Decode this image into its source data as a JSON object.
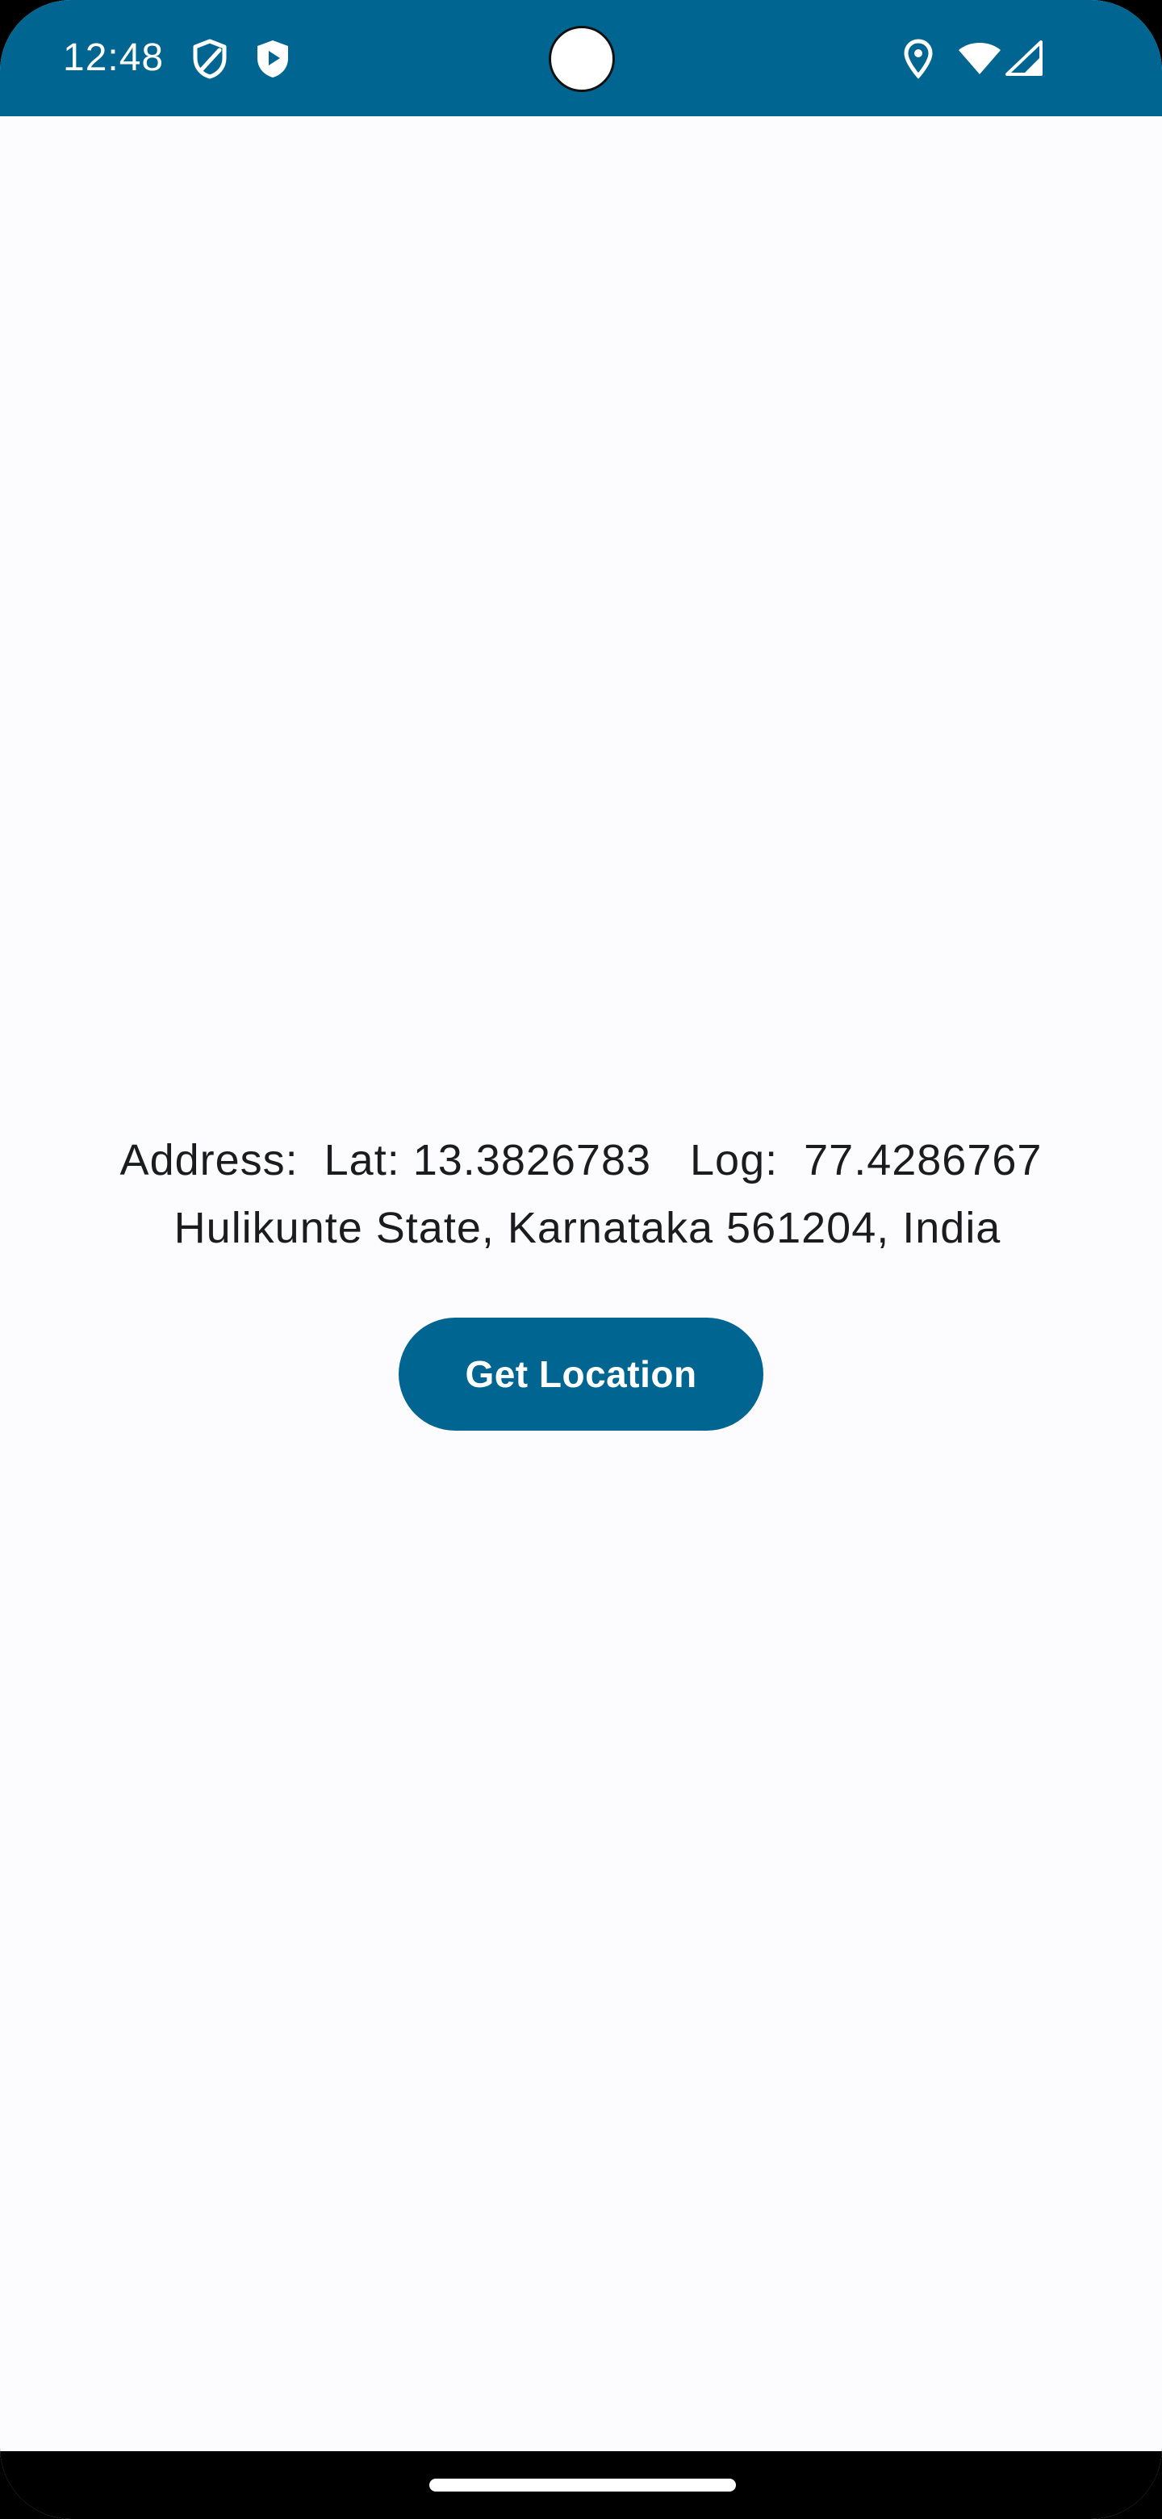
{
  "status_bar": {
    "time": "12:48",
    "left_icons": [
      "shield-outline-icon",
      "shield-play-icon"
    ],
    "right_icons": [
      "location-pin-icon",
      "wifi-icon",
      "cell-signal-icon"
    ],
    "color": "#006590"
  },
  "location": {
    "coordinates_line": "Address:  Lat: 13.3826783   Log:  77.4286767",
    "address_line": " Hulikunte State, Karnataka 561204, India"
  },
  "actions": {
    "get_location_label": "Get Location"
  },
  "colors": {
    "primary": "#006590",
    "background": "#fcfcff",
    "text": "#1a1c1e"
  }
}
